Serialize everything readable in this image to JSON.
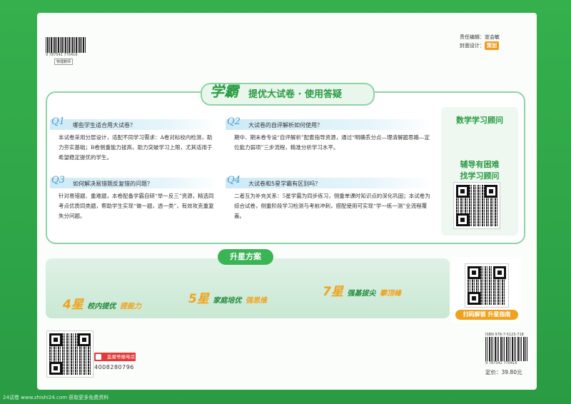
{
  "credits": {
    "editor": "责任编辑：宣会敏",
    "design_prefix": "封面设计：",
    "design_logo": "策划"
  },
  "top_barcode": {
    "number": "9 787542 770416",
    "label": "物理教师"
  },
  "title": {
    "brand": "学霸",
    "text": "提优大试卷 · 使用答疑"
  },
  "qa": [
    {
      "num": "Q1",
      "question": "哪些学生适合用大试卷？",
      "answer": "本试卷采用分层设计，适配不同学习需求：A卷对标校内检测，助力夯实基础；B卷侧重能力拔高，助力突破学习上限，尤其适用于希望稳定提优的学生。"
    },
    {
      "num": "Q2",
      "question": "大试卷的自评解析如何使用？",
      "answer": "期中、期末卷专设“自评解析”配套指导资源，通过“明确丢分点—理清解题思路—定位能力弱项”三步流程，精准分析学习水平。"
    },
    {
      "num": "Q3",
      "question": "如何解决易错题反复错的问题？",
      "answer": "针对易错题、重难题，本卷配备学霸自研“举一反三”资源，精选同考点优质同类题，帮助学生实现“做一题，透一类”，有效攻克重复失分问题。"
    },
    {
      "num": "Q4",
      "question": "大试卷和5星学霸有区别吗？",
      "answer": "二者互为补充关系：5星学霸为同步练习，侧重单课时知识点的深化巩固；本试卷为综合试卷，侧重阶段学习检测与考前冲刺，搭配使用可实现“学一练一测”全流程覆盖。"
    }
  ],
  "advisor": {
    "title": "数学学习顾问",
    "line1": "辅导有困难",
    "line2": "找学习顾问"
  },
  "plan": {
    "title": "升星方案",
    "steps": [
      {
        "num": "4星",
        "a": "校内提优",
        "b": "提能力"
      },
      {
        "num": "5星",
        "a": "家庭培优",
        "b": "强思维"
      },
      {
        "num": "7星",
        "a": "强基拔尖",
        "b": "攀顶峰"
      }
    ],
    "scan_label": "扫码解锁 升星指南"
  },
  "hotline": {
    "label": "监督举报电话",
    "number": "4008280796"
  },
  "isbn": {
    "text": "ISBN 978-7-5123-718",
    "number": "9 787542 770416",
    "price": "定价：39.80元"
  },
  "footer": "24试卷 www.zhishi24.com 获取更多免费资料",
  "colors": {
    "background_green": "#2fa84a",
    "accent_green": "#2a9b43",
    "accent_orange": "#f0a21c",
    "question_blue": "#4aa0cc",
    "badge_red": "#e23a3a"
  }
}
